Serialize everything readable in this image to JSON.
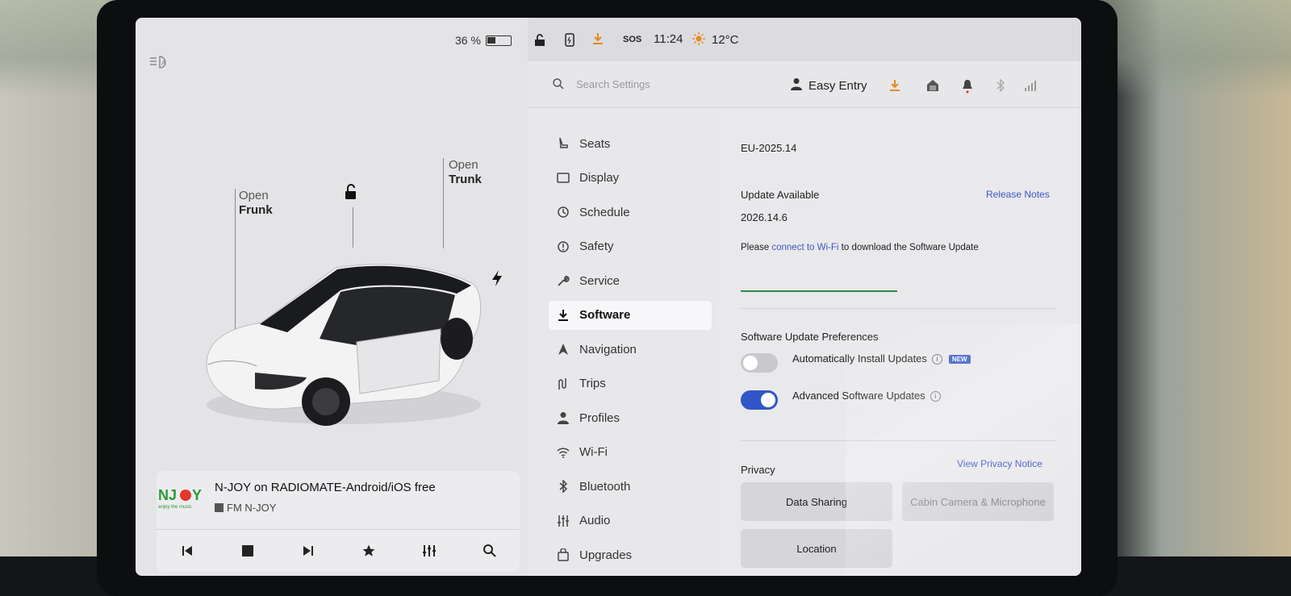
{
  "status": {
    "battery_percent": "36 %",
    "battery_level": 0.36,
    "time": "11:24",
    "temperature": "12°C",
    "sos": "SOS"
  },
  "vehicle": {
    "frunk_action": "Open",
    "frunk_label": "Frunk",
    "trunk_action": "Open",
    "trunk_label": "Trunk"
  },
  "media": {
    "logo_text": "NJOY",
    "logo_tagline": "enjoy the music",
    "title": "N-JOY on RADIOMATE-Android/iOS free",
    "station": "FM N-JOY"
  },
  "header": {
    "search_placeholder": "Search Settings",
    "profile_name": "Easy Entry"
  },
  "nav": {
    "items": [
      {
        "label": "Seats",
        "icon": "seat-icon"
      },
      {
        "label": "Display",
        "icon": "display-icon"
      },
      {
        "label": "Schedule",
        "icon": "clock-icon"
      },
      {
        "label": "Safety",
        "icon": "alert-icon"
      },
      {
        "label": "Service",
        "icon": "wrench-icon"
      },
      {
        "label": "Software",
        "icon": "download-icon",
        "active": true
      },
      {
        "label": "Navigation",
        "icon": "navigation-icon"
      },
      {
        "label": "Trips",
        "icon": "trips-icon"
      },
      {
        "label": "Profiles",
        "icon": "person-icon"
      },
      {
        "label": "Wi-Fi",
        "icon": "wifi-icon"
      },
      {
        "label": "Bluetooth",
        "icon": "bluetooth-icon"
      },
      {
        "label": "Audio",
        "icon": "equalizer-icon"
      },
      {
        "label": "Upgrades",
        "icon": "bag-icon"
      }
    ]
  },
  "software": {
    "current_version": "EU-2025.14",
    "update_available_label": "Update Available",
    "release_notes_link": "Release Notes",
    "update_version": "2026.14.6",
    "wifi_message_prefix": "Please",
    "wifi_link": "connect to Wi-Fi",
    "wifi_message_suffix": "to download the Software Update",
    "preferences_title": "Software Update Preferences",
    "auto_install_label": "Automatically Install Updates",
    "auto_install_enabled": false,
    "new_badge": "NEW",
    "advanced_label": "Advanced Software Updates",
    "advanced_enabled": true
  },
  "privacy": {
    "title": "Privacy",
    "view_notice_link": "View Privacy Notice",
    "buttons": [
      "Data Sharing",
      "Cabin Camera & Microphone",
      "Location"
    ]
  },
  "colors": {
    "accent": "#2f57c7",
    "progress": "#2b8c3f",
    "download_icon": "#e58a1f"
  }
}
